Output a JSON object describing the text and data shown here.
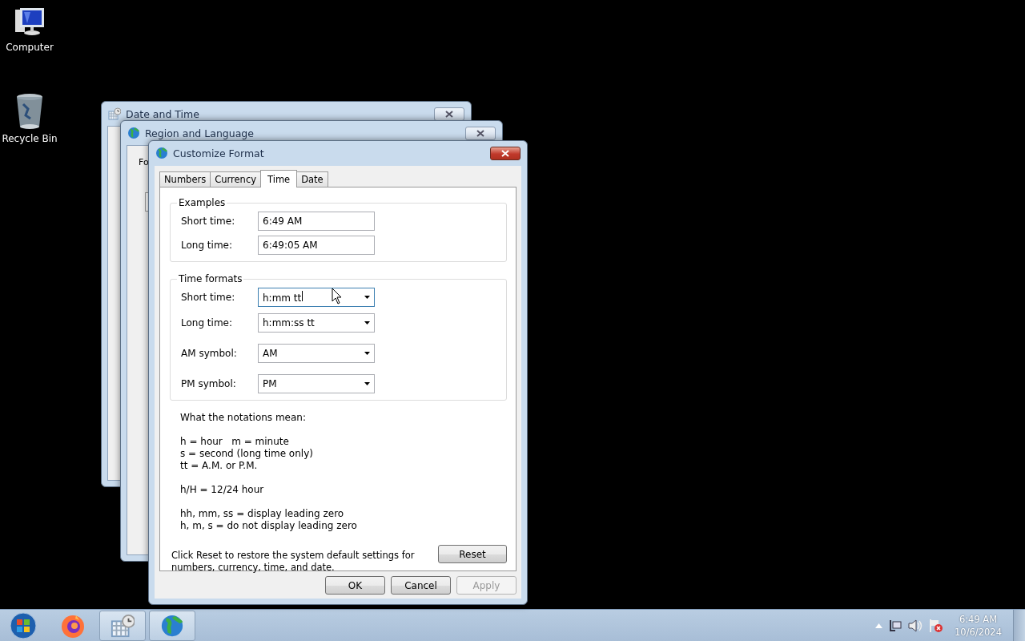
{
  "desktop_icons": [
    {
      "label": "Computer",
      "kind": "computer"
    },
    {
      "label": "Recycle Bin",
      "kind": "recycle"
    }
  ],
  "background_windows": [
    {
      "title": "Date and Time",
      "kind": "datetime"
    },
    {
      "title": "Region and Language",
      "kind": "region",
      "labels": [
        "Fo"
      ]
    }
  ],
  "dialog": {
    "title": "Customize Format",
    "tabs": [
      {
        "label": "Numbers",
        "selected": false
      },
      {
        "label": "Currency",
        "selected": false
      },
      {
        "label": "Time",
        "selected": true
      },
      {
        "label": "Date",
        "selected": false
      }
    ],
    "examples": {
      "title": "Examples",
      "rows": [
        {
          "label": "Short time:",
          "value": "6:49 AM"
        },
        {
          "label": "Long time:",
          "value": "6:49:05 AM"
        }
      ]
    },
    "formats": {
      "title": "Time formats",
      "rows": [
        {
          "label": "Short time:",
          "value": "h:mm tt",
          "focused": true
        },
        {
          "label": "Long time:",
          "value": "h:mm:ss tt",
          "focused": false
        },
        {
          "label": "AM symbol:",
          "value": "AM",
          "focused": false
        },
        {
          "label": "PM symbol:",
          "value": "PM",
          "focused": false
        }
      ]
    },
    "notes": [
      [
        "What the notations mean:"
      ],
      [
        "h = hour   m = minute",
        "s = second (long time only)",
        "tt = A.M. or P.M."
      ],
      [
        "h/H = 12/24 hour"
      ],
      [
        "hh, mm, ss = display leading zero",
        "h, m, s = do not display leading zero"
      ]
    ],
    "reset_text": "Click Reset to restore the system default settings for numbers, currency, time, and date.",
    "reset_button": "Reset",
    "buttons": [
      {
        "label": "OK",
        "disabled": false
      },
      {
        "label": "Cancel",
        "disabled": false
      },
      {
        "label": "Apply",
        "disabled": true
      }
    ]
  },
  "taskbar": {
    "items": [
      {
        "kind": "start",
        "active": false
      },
      {
        "kind": "firefox",
        "active": false
      },
      {
        "kind": "datetime",
        "active": true
      },
      {
        "kind": "region",
        "active": true
      }
    ],
    "tray": {
      "time": "6:49 AM",
      "date": "10/6/2024"
    }
  }
}
